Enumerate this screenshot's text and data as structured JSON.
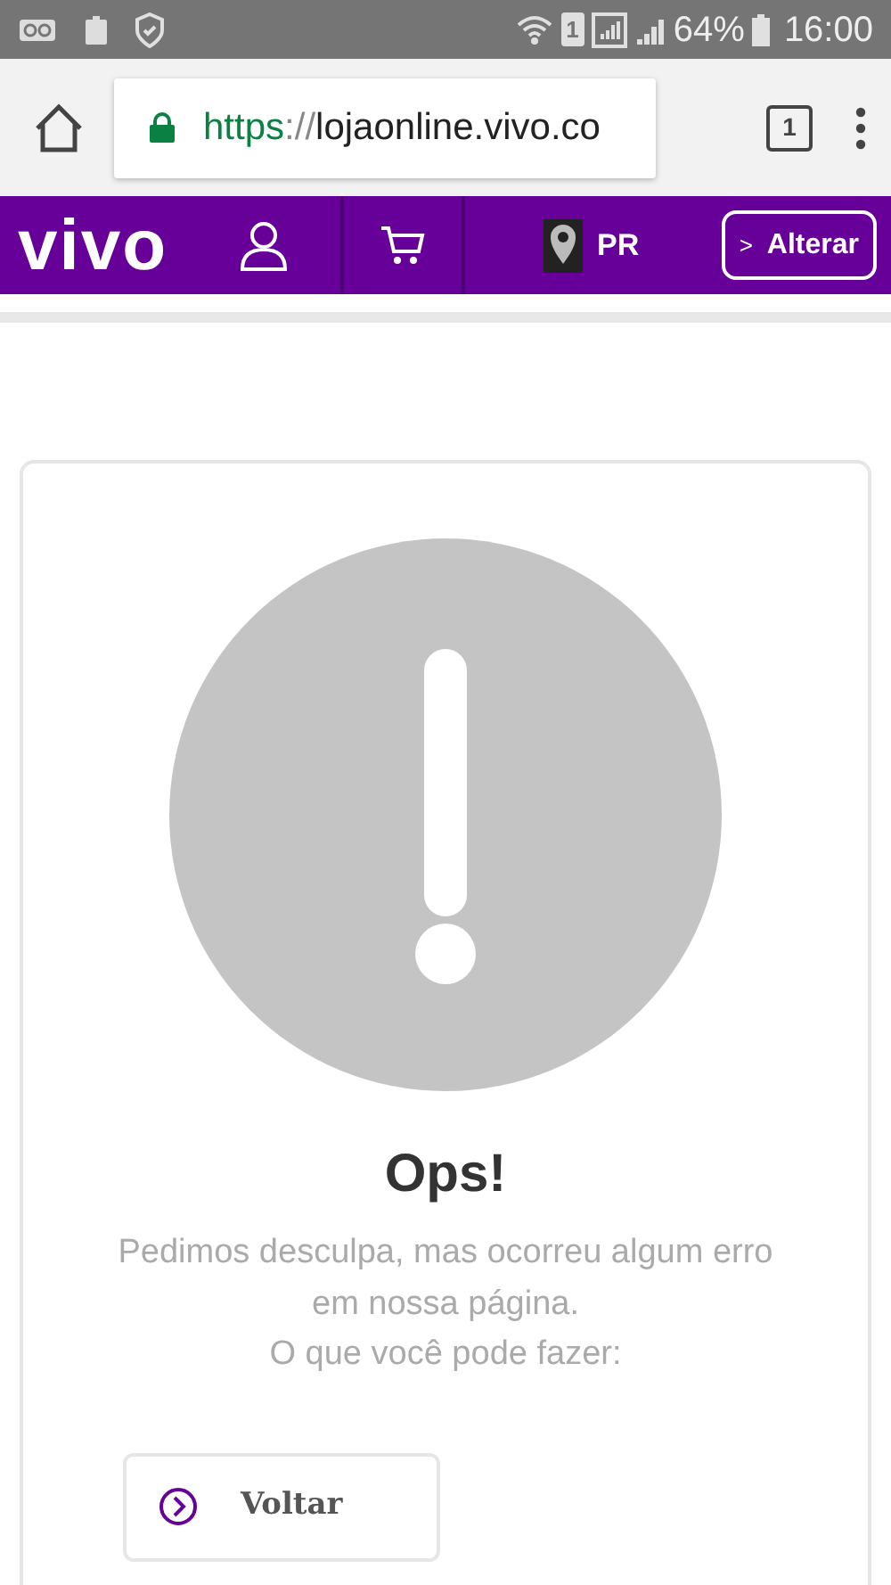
{
  "status_bar": {
    "sim": "1",
    "battery": "64%",
    "time": "16:00"
  },
  "browser": {
    "url_scheme": "https",
    "url_separator": "://",
    "url_host": "lojaonline.vivo.co",
    "tab_count": "1"
  },
  "header": {
    "logo": "vivo",
    "region": "PR",
    "change_button": "Alterar",
    "change_glyph": ">"
  },
  "error": {
    "title": "Ops!",
    "message": "Pedimos desculpa, mas ocorreu algum erro em nossa página.",
    "prompt": "O que você pode fazer:",
    "back_button": "Voltar"
  }
}
